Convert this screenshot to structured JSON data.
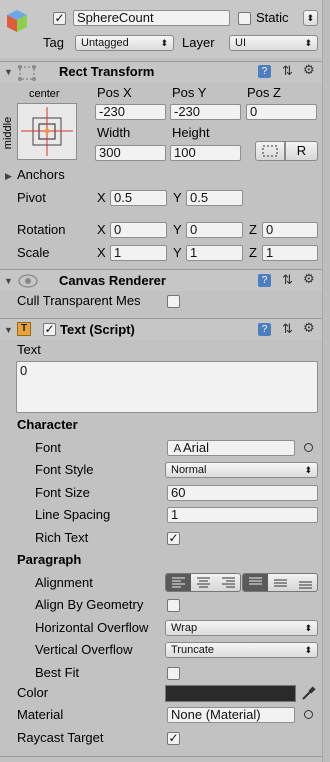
{
  "gameobject": {
    "active": true,
    "name": "SphereCount",
    "static_label": "Static",
    "static_checked": false,
    "tag_label": "Tag",
    "tag_value": "Untagged",
    "layer_label": "Layer",
    "layer_value": "UI"
  },
  "rect_transform": {
    "title": "Rect Transform",
    "anchor_h": "center",
    "anchor_v": "middle",
    "pos_x_label": "Pos X",
    "pos_x": "-230",
    "pos_y_label": "Pos Y",
    "pos_y": "-230",
    "pos_z_label": "Pos Z",
    "pos_z": "0",
    "width_label": "Width",
    "width": "300",
    "height_label": "Height",
    "height": "100",
    "raw_button": "R",
    "anchors_label": "Anchors",
    "pivot_label": "Pivot",
    "pivot_x": "0.5",
    "pivot_y": "0.5",
    "rotation_label": "Rotation",
    "rot_x": "0",
    "rot_y": "0",
    "rot_z": "0",
    "scale_label": "Scale",
    "scale_x": "1",
    "scale_y": "1",
    "scale_z": "1",
    "x": "X",
    "y": "Y",
    "z": "Z"
  },
  "canvas_renderer": {
    "title": "Canvas Renderer",
    "cull_label": "Cull Transparent Mes",
    "cull_checked": false
  },
  "text_script": {
    "enabled": true,
    "title": "Text (Script)",
    "text_label": "Text",
    "text_value": "0",
    "character_header": "Character",
    "font_label": "Font",
    "font_value": "Arial",
    "font_style_label": "Font Style",
    "font_style_value": "Normal",
    "font_size_label": "Font Size",
    "font_size_value": "60",
    "line_spacing_label": "Line Spacing",
    "line_spacing_value": "1",
    "rich_text_label": "Rich Text",
    "rich_text_checked": true,
    "paragraph_header": "Paragraph",
    "alignment_label": "Alignment",
    "align_geometry_label": "Align By Geometry",
    "align_geometry_checked": false,
    "h_overflow_label": "Horizontal Overflow",
    "h_overflow_value": "Wrap",
    "v_overflow_label": "Vertical Overflow",
    "v_overflow_value": "Truncate",
    "best_fit_label": "Best Fit",
    "best_fit_checked": false,
    "color_label": "Color",
    "color_value": "#2a2a2a",
    "material_label": "Material",
    "material_value": "None (Material)",
    "raycast_label": "Raycast Target",
    "raycast_checked": true
  },
  "icons": {
    "checked_glyph": "✓",
    "dropdown_arrow": "⬍",
    "fold_open": "▼",
    "fold_closed": "▶"
  }
}
